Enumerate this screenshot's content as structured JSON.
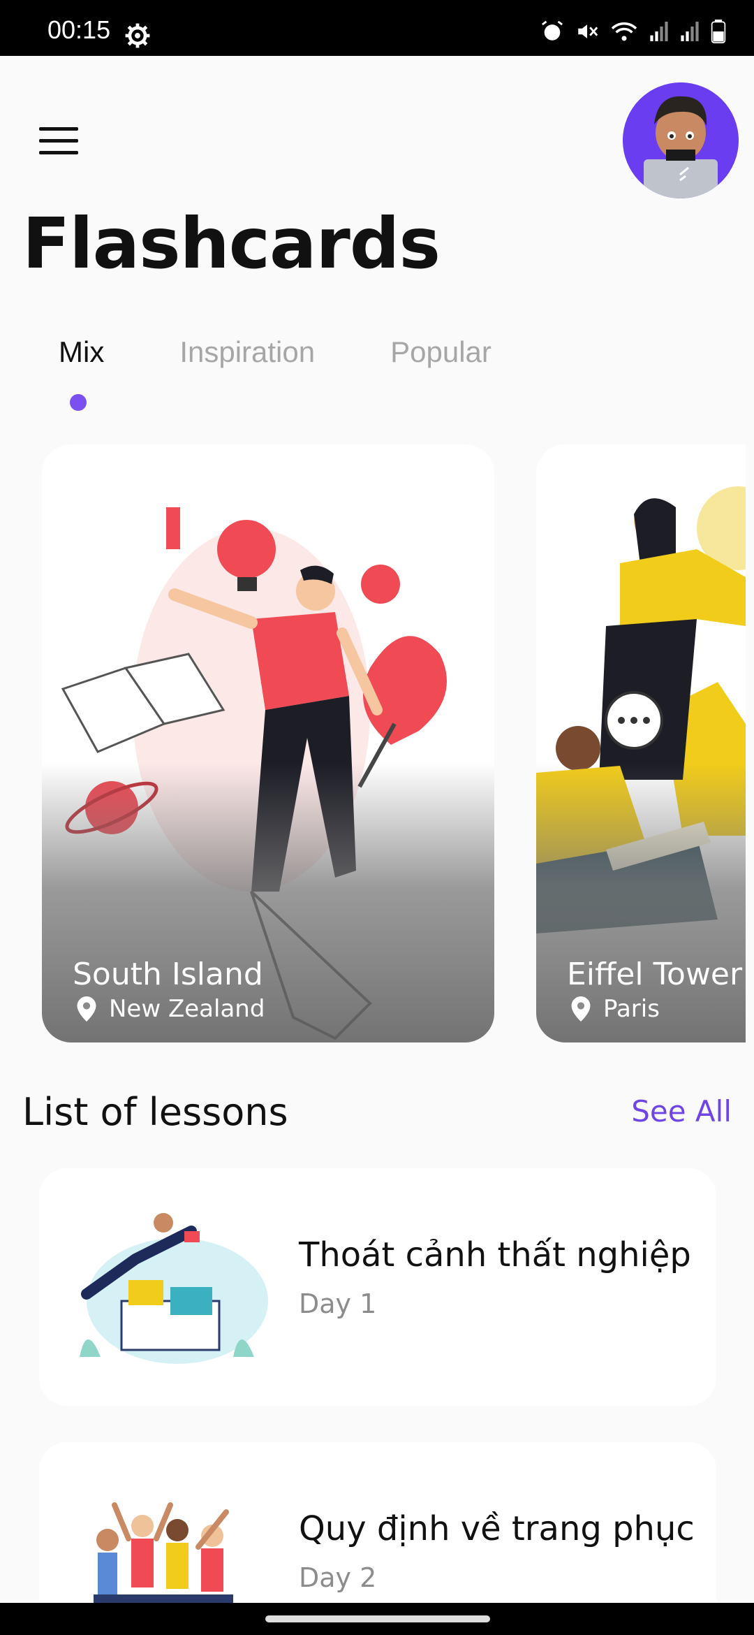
{
  "status_bar": {
    "time": "00:15",
    "icons": [
      "settings-icon",
      "alarm-icon",
      "mute-icon",
      "wifi-icon",
      "signal-icon",
      "signal-icon",
      "battery-icon"
    ]
  },
  "header": {
    "menu_icon": "hamburger-menu-icon",
    "avatar": "user-avatar"
  },
  "page": {
    "title": "Flashcards"
  },
  "tabs": [
    {
      "label": "Mix",
      "active": true
    },
    {
      "label": "Inspiration",
      "active": false
    },
    {
      "label": "Popular",
      "active": false
    }
  ],
  "cards": [
    {
      "title": "South Island",
      "location": "New Zealand"
    },
    {
      "title": "Eiffel Tower",
      "location": "Paris"
    }
  ],
  "lessons_section": {
    "title": "List of lessons",
    "see_all": "See All"
  },
  "lessons": [
    {
      "title": "Thoát cảnh thất nghiệp",
      "day": "Day 1"
    },
    {
      "title": "Quy định về trang phục",
      "day": "Day 2"
    }
  ],
  "colors": {
    "accent": "#7b4ff0",
    "see_all": "#6f45e8",
    "card_red": "#f04a55",
    "card_yellow": "#f2cc1a"
  }
}
